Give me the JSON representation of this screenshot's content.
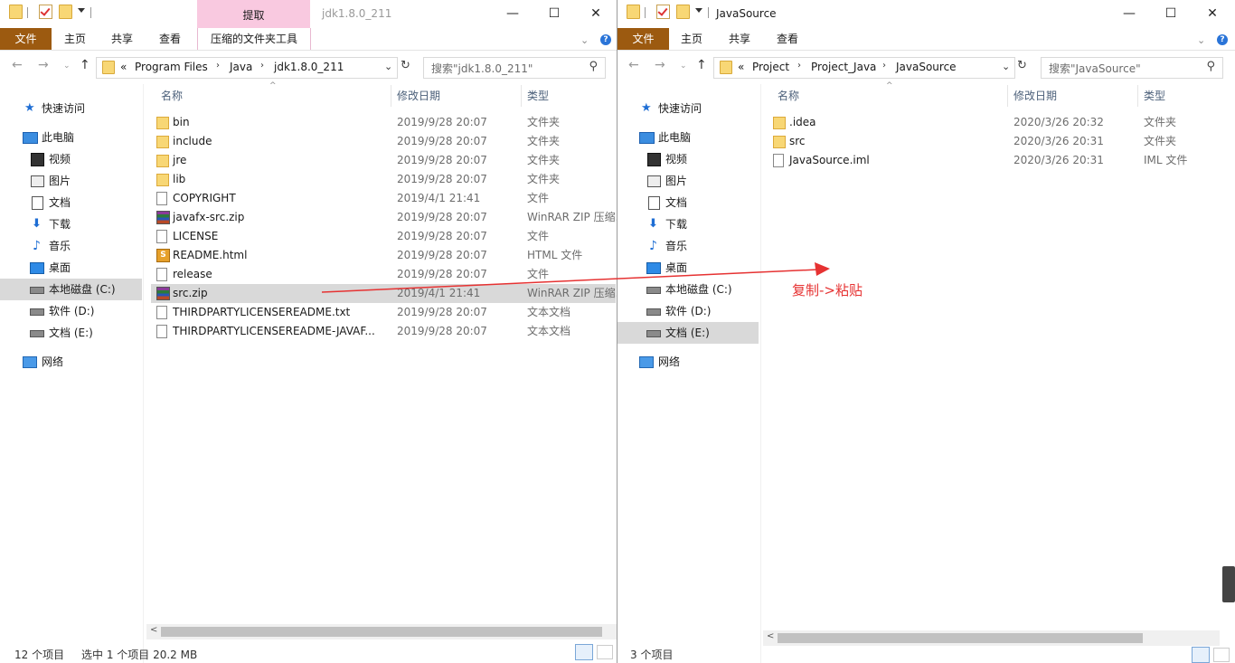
{
  "left": {
    "title": "jdk1.8.0_211",
    "context_tab": "提取",
    "ribbon_tabs": [
      "文件",
      "主页",
      "共享",
      "查看",
      "压缩的文件夹工具"
    ],
    "breadcrumb": [
      "Program Files",
      "Java",
      "jdk1.8.0_211"
    ],
    "breadcrumb_prefix": "«",
    "search_placeholder": "搜索\"jdk1.8.0_211\"",
    "columns": [
      "名称",
      "修改日期",
      "类型"
    ],
    "nav": [
      "快速访问",
      "此电脑",
      "视频",
      "图片",
      "文档",
      "下载",
      "音乐",
      "桌面",
      "本地磁盘 (C:)",
      "软件 (D:)",
      "文档 (E:)",
      "网络"
    ],
    "files": [
      {
        "name": "bin",
        "date": "2019/9/28 20:07",
        "type": "文件夹",
        "icon": "folder-icon"
      },
      {
        "name": "include",
        "date": "2019/9/28 20:07",
        "type": "文件夹",
        "icon": "folder-icon"
      },
      {
        "name": "jre",
        "date": "2019/9/28 20:07",
        "type": "文件夹",
        "icon": "folder-icon"
      },
      {
        "name": "lib",
        "date": "2019/9/28 20:07",
        "type": "文件夹",
        "icon": "folder-icon"
      },
      {
        "name": "COPYRIGHT",
        "date": "2019/4/1 21:41",
        "type": "文件",
        "icon": "file-icon"
      },
      {
        "name": "javafx-src.zip",
        "date": "2019/9/28 20:07",
        "type": "WinRAR ZIP 压缩...",
        "icon": "winrar-icon"
      },
      {
        "name": "LICENSE",
        "date": "2019/9/28 20:07",
        "type": "文件",
        "icon": "file-icon"
      },
      {
        "name": "README.html",
        "date": "2019/9/28 20:07",
        "type": "HTML 文件",
        "icon": "html-icon"
      },
      {
        "name": "release",
        "date": "2019/9/28 20:07",
        "type": "文件",
        "icon": "file-icon"
      },
      {
        "name": "src.zip",
        "date": "2019/4/1 21:41",
        "type": "WinRAR ZIP 压缩...",
        "icon": "winrar-icon"
      },
      {
        "name": "THIRDPARTYLICENSEREADME.txt",
        "date": "2019/9/28 20:07",
        "type": "文本文档",
        "icon": "text-file-icon"
      },
      {
        "name": "THIRDPARTYLICENSEREADME-JAVAF...",
        "date": "2019/9/28 20:07",
        "type": "文本文档",
        "icon": "text-file-icon"
      }
    ],
    "status_count": "12 个项目",
    "status_selected": "选中 1 个项目  20.2 MB"
  },
  "right": {
    "title": "JavaSource",
    "ribbon_tabs": [
      "文件",
      "主页",
      "共享",
      "查看"
    ],
    "breadcrumb": [
      "Project",
      "Project_Java",
      "JavaSource"
    ],
    "breadcrumb_prefix": "«",
    "search_placeholder": "搜索\"JavaSource\"",
    "columns": [
      "名称",
      "修改日期",
      "类型"
    ],
    "nav": [
      "快速访问",
      "此电脑",
      "视频",
      "图片",
      "文档",
      "下载",
      "音乐",
      "桌面",
      "本地磁盘 (C:)",
      "软件 (D:)",
      "文档 (E:)",
      "网络"
    ],
    "files": [
      {
        "name": ".idea",
        "date": "2020/3/26 20:32",
        "type": "文件夹",
        "icon": "folder-icon"
      },
      {
        "name": "src",
        "date": "2020/3/26 20:31",
        "type": "文件夹",
        "icon": "folder-icon"
      },
      {
        "name": "JavaSource.iml",
        "date": "2020/3/26 20:31",
        "type": "IML 文件",
        "icon": "file-icon"
      }
    ],
    "status_count": "3 个项目"
  },
  "annotation": "复制->粘贴",
  "annotation_color": "#e63232",
  "window_controls": {
    "minimize": "—",
    "maximize": "☐",
    "close": "✕"
  }
}
